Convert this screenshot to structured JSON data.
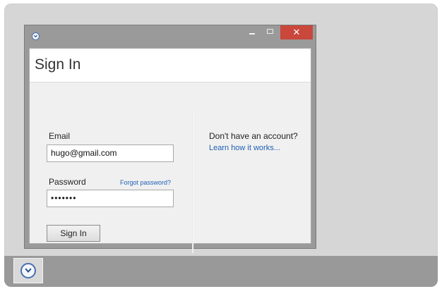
{
  "window": {
    "title": "Sign In",
    "controls": {
      "minimize_icon": "minimize-icon",
      "maximize_icon": "maximize-icon",
      "close_label": "✕"
    }
  },
  "form": {
    "email_label": "Email",
    "email_value": "hugo@gmail.com",
    "password_label": "Password",
    "forgot_link": "Forgot password?",
    "password_value": "•••••••",
    "submit_label": "Sign In"
  },
  "side": {
    "prompt": "Don't have an account?",
    "learn_link": "Learn how it works..."
  },
  "taskbar": {
    "app_icon": "clock-icon"
  },
  "colors": {
    "close": "#c9473b",
    "link": "#1f5fb5",
    "accent": "#4a70b0"
  }
}
